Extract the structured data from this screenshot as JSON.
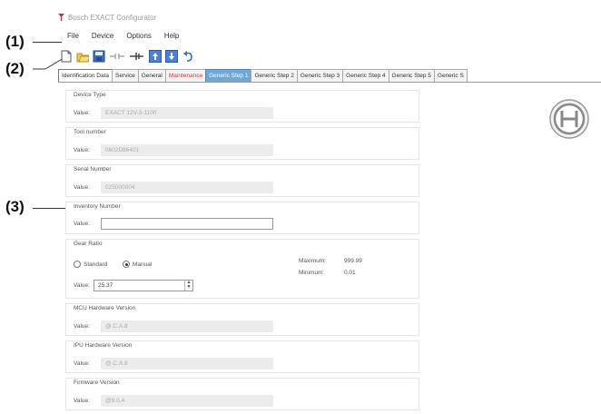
{
  "callouts": {
    "c1": "(1)",
    "c2": "(2)",
    "c3": "(3)"
  },
  "window": {
    "title": "Bosch EXACT Configurator"
  },
  "menu": {
    "file": "File",
    "device": "Device",
    "options": "Options",
    "help": "Help"
  },
  "toolbar": {
    "icons": [
      "new-file-icon",
      "open-folder-icon",
      "save-icon",
      "disconnected-icon",
      "connected-icon",
      "upload-icon",
      "download-icon",
      "undo-icon"
    ]
  },
  "tabs": [
    {
      "label": "Identification Data"
    },
    {
      "label": "Service"
    },
    {
      "label": "General"
    },
    {
      "label": "Maintenance"
    },
    {
      "label": "Generic Step 1"
    },
    {
      "label": "Generic Step 2"
    },
    {
      "label": "Generic Step 3"
    },
    {
      "label": "Generic Step 4"
    },
    {
      "label": "Generic Step 5"
    },
    {
      "label": "Generic S"
    }
  ],
  "colors": {
    "maintenance_tab": "#d23b3b",
    "selected_tab": "#6fa7d6"
  },
  "common": {
    "value_label": "Value:"
  },
  "device_type": {
    "title": "Device Type",
    "value": "EXACT 12V-3-1100"
  },
  "tool_number": {
    "title": "Tool number",
    "value": "0602D86401"
  },
  "serial_number": {
    "title": "Serial Number",
    "value": "025000004"
  },
  "inventory_number": {
    "title": "Inventory Number",
    "value": ""
  },
  "gear_ratio": {
    "title": "Gear Ratio",
    "standard_label": "Standard",
    "manual_label": "Manual",
    "selected": "Manual",
    "value": "25.37",
    "maximum_label": "Maximum:",
    "maximum_value": "999.99",
    "minimum_label": "Minimum:",
    "minimum_value": "0.01"
  },
  "mcu_hw": {
    "title": "MCU Hardware Version",
    "value": "@.C.A.8"
  },
  "ipu_hw": {
    "title": "IPU Hardware Version",
    "value": "@.C.A.8"
  },
  "firmware": {
    "title": "Firmware Version",
    "value": "@8.0.4"
  }
}
